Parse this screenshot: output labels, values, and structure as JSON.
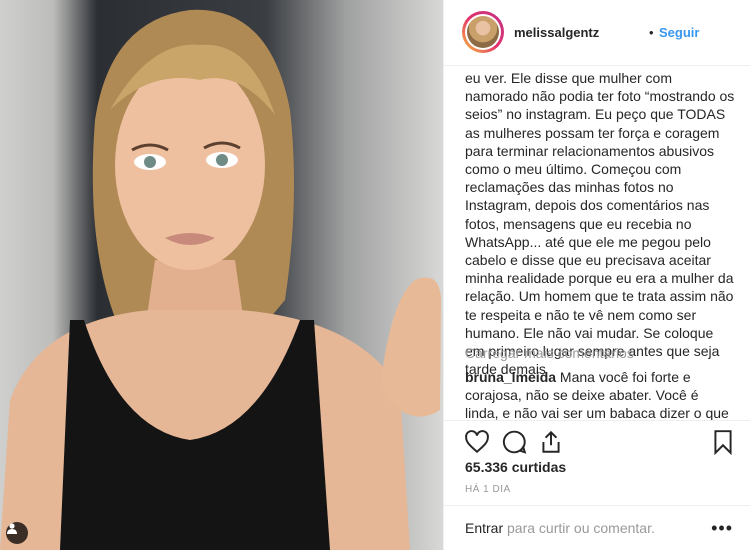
{
  "post": {
    "username": "melissalgentz",
    "separator": "•",
    "follow_label": "Seguir",
    "caption": "eu ver. Ele disse que mulher com namorado não podia ter foto “mostrando os seios” no instagram. Eu peço que TODAS as mulheres possam ter força e coragem para terminar relacionamentos abusivos como o meu último. Começou com reclamações das minhas fotos no Instagram, depois dos comentários nas fotos, mensagens que eu recebia no WhatsApp... até que ele me pegou pelo cabelo e disse que eu precisava aceitar minha realidade porque eu era a mulher da relação. Um homem que te trata assim não te respeita e não te vê nem como ser humano. Ele não vai mudar. Se coloque em primeiro lugar sempre antes que seja tarde demais",
    "load_more": "Carregar mais comentários",
    "comment": {
      "author": "bruna_lmeida",
      "text": "Mana você foi forte e corajosa, não se deixe abater. Você é linda, e não vai ser um babaca dizer o que você"
    },
    "likes": "65.336 curtidas",
    "time": "HÁ 1 DIA",
    "footer": {
      "login_link": "Entrar",
      "login_rest": " para curtir ou comentar.",
      "more": "•••"
    }
  },
  "icons": [
    "user-tag-icon",
    "heart-icon",
    "comment-icon",
    "share-icon",
    "bookmark-icon",
    "more-options-icon"
  ],
  "colors": {
    "link": "#3897f0",
    "text": "#262626",
    "muted": "#999999",
    "border": "#efefef"
  }
}
